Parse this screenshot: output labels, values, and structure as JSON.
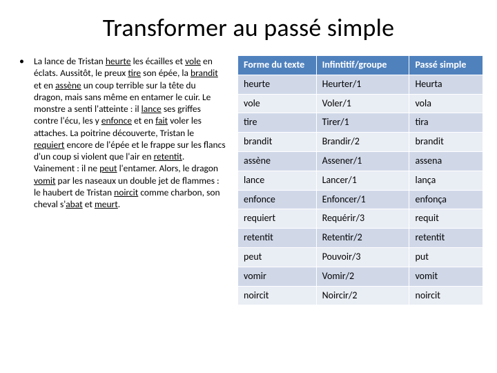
{
  "title": "Transformer au passé simple",
  "paragraph": {
    "segments": [
      {
        "t": "La lance de Tristan "
      },
      {
        "t": "heurte",
        "u": true
      },
      {
        "t": " les écailles et "
      },
      {
        "t": "vole",
        "u": true
      },
      {
        "t": " en éclats. Aussitôt, le preux "
      },
      {
        "t": "tire",
        "u": true
      },
      {
        "t": " son épée, la "
      },
      {
        "t": "brandit",
        "u": true
      },
      {
        "t": " et en "
      },
      {
        "t": "assène",
        "u": true
      },
      {
        "t": " un coup terrible sur la tête du dragon, mais sans même en entamer le cuir. Le monstre a senti l'atteinte : il "
      },
      {
        "t": "lance",
        "u": true
      },
      {
        "t": " ses griffes contre l'écu, les y "
      },
      {
        "t": "enfonce",
        "u": true
      },
      {
        "t": " et en "
      },
      {
        "t": "fait",
        "u": true
      },
      {
        "t": " voler les attaches. La poitrine découverte, Tristan le "
      },
      {
        "t": "requiert",
        "u": true
      },
      {
        "t": " encore de l'épée et le frappe sur les flancs d'un coup si violent que l'air en "
      },
      {
        "t": "retentit",
        "u": true
      },
      {
        "t": ". Vainement : il ne "
      },
      {
        "t": "peut",
        "u": true
      },
      {
        "t": " l'entamer. Alors, le dragon "
      },
      {
        "t": "vomit",
        "u": true
      },
      {
        "t": " par les naseaux un double jet de flammes : le haubert de Tristan "
      },
      {
        "t": "noircit",
        "u": true
      },
      {
        "t": " comme charbon, son cheval s'"
      },
      {
        "t": "abat",
        "u": true
      },
      {
        "t": " et "
      },
      {
        "t": "meurt",
        "u": true
      },
      {
        "t": "."
      }
    ]
  },
  "table": {
    "headers": [
      "Forme du texte",
      "Infintitif/groupe",
      "Passé simple"
    ],
    "rows": [
      [
        "heurte",
        "Heurter/1",
        "Heurta"
      ],
      [
        "vole",
        "Voler/1",
        "vola"
      ],
      [
        "tire",
        "Tirer/1",
        "tira"
      ],
      [
        "brandit",
        "Brandir/2",
        "brandit"
      ],
      [
        "assène",
        "Assener/1",
        "assena"
      ],
      [
        "lance",
        "Lancer/1",
        "lança"
      ],
      [
        "enfonce",
        "Enfoncer/1",
        "enfonça"
      ],
      [
        "requiert",
        "Requérir/3",
        "requit"
      ],
      [
        "retentit",
        "Retentir/2",
        "retentit"
      ],
      [
        "peut",
        "Pouvoir/3",
        "put"
      ],
      [
        "vomir",
        "Vomir/2",
        "vomit"
      ],
      [
        "noircit",
        "Noircir/2",
        "noircit"
      ]
    ]
  }
}
